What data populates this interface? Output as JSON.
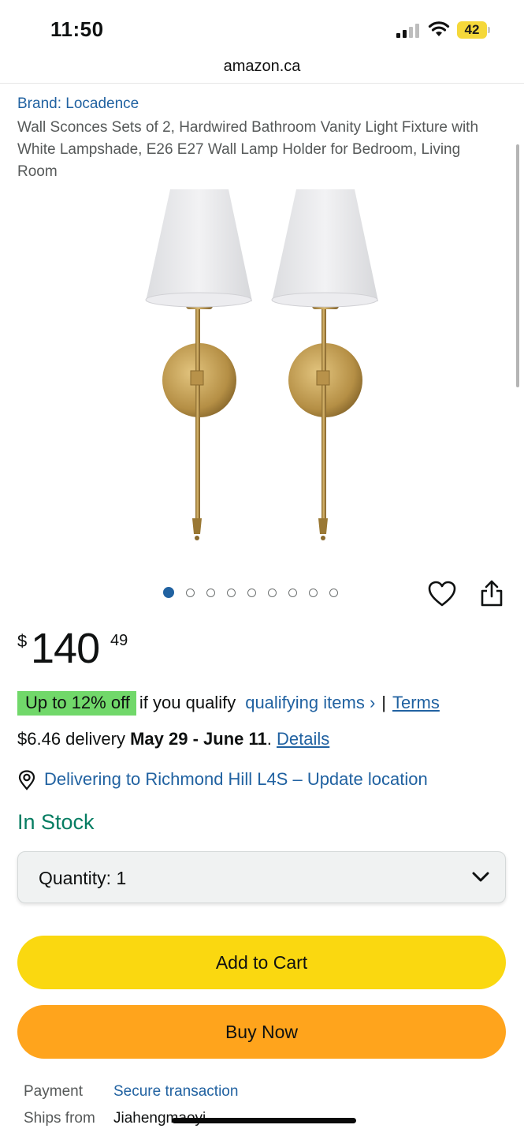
{
  "status_bar": {
    "time": "11:50",
    "battery_level": "42"
  },
  "browser": {
    "url": "amazon.ca"
  },
  "product": {
    "brand": "Brand: Locadence",
    "title": "Wall Sconces Sets of 2, Hardwired Bathroom Vanity Light Fixture with White Lampshade, E26 E27 Wall Lamp Holder for Bedroom, Living Room",
    "image_icon": "wall-sconce-pair-image",
    "image_count": 9,
    "active_image_index": 0
  },
  "price": {
    "symbol": "$",
    "whole": "140",
    "fraction": "49"
  },
  "promo": {
    "badge": "Up to 12% off",
    "text": "if you qualify",
    "link": "qualifying items ›",
    "separator": "|",
    "terms": "Terms"
  },
  "delivery": {
    "prefix": "$6.46 delivery",
    "dates": "May 29 - June 11",
    "suffix": ".",
    "details": "Details"
  },
  "location": {
    "icon": "location-pin-icon",
    "text": "Delivering to Richmond Hill L4S – Update location"
  },
  "stock": {
    "status": "In Stock"
  },
  "quantity": {
    "label": "Quantity:",
    "value": "1"
  },
  "buttons": {
    "add_to_cart": "Add to Cart",
    "buy_now": "Buy Now"
  },
  "info": {
    "payment_label": "Payment",
    "payment_value": "Secure transaction",
    "ships_label": "Ships from",
    "ships_value": "Jiahengmaoyi"
  },
  "colors": {
    "link": "#2162a1",
    "promo_badge": "#71d86a",
    "in_stock": "#067d62",
    "add_to_cart": "#fad810",
    "buy_now": "#ffa41c"
  }
}
